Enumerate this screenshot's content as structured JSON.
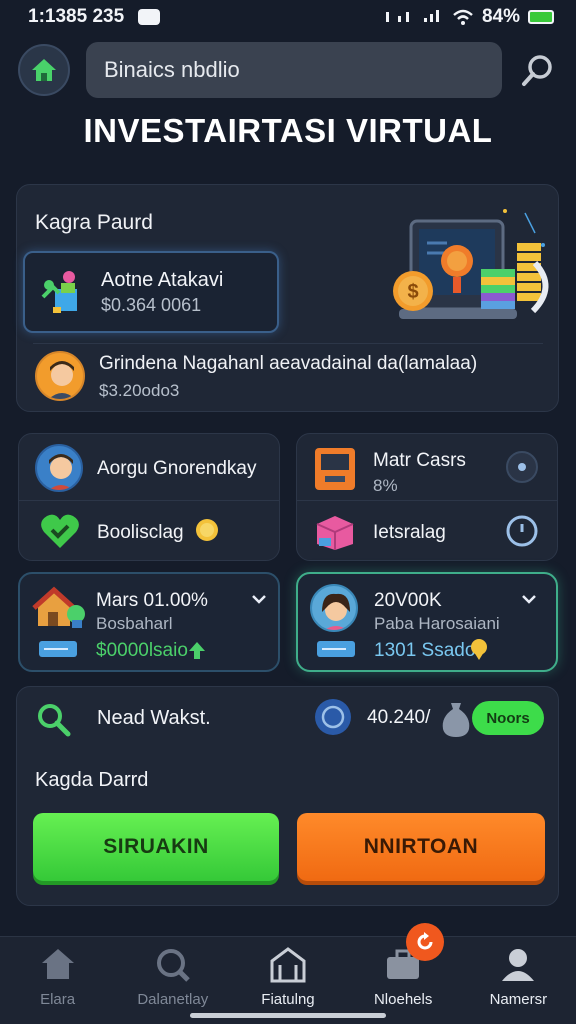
{
  "status": {
    "time": "1:1385 235",
    "battery": "84%"
  },
  "search": {
    "value": "Binaics nbdlio"
  },
  "page": {
    "title": "INVESTAIRTASI VIRTUAL"
  },
  "portfolio": {
    "title": "Kagra Paurd",
    "active_asset": {
      "name": "Aotne Atakavi",
      "value": "$0.364 0061"
    },
    "user": {
      "name": "Grindena Nagahanl aeavadainal da(lamalaa)",
      "value": "$3.20odo3"
    }
  },
  "info_cards": {
    "left_top": {
      "label": "Aorgu Gnorendkay"
    },
    "left_bottom": {
      "label": "Boolisclag"
    },
    "right_top": {
      "label": "Matr Casrs",
      "sub": "8%"
    },
    "right_bottom": {
      "label": "Ietsralag"
    }
  },
  "stat_cards": {
    "left": {
      "title": "Mars 01.00%",
      "sub": "Bosbaharl",
      "value": "$0000lsaio"
    },
    "right": {
      "title": "20V00K",
      "sub": "Paba Harosaiani",
      "value": "1301 Ssado"
    }
  },
  "action": {
    "row_label": "Nead Wakst.",
    "row_value": "40.240/",
    "toggle": "Noors",
    "section_label": "Kagda Darrd",
    "btn_primary": "SIRUAKIN",
    "btn_secondary": "NNIRTOAN"
  },
  "nav": [
    {
      "label": "Elara",
      "active": false
    },
    {
      "label": "Dalanetlay",
      "active": false
    },
    {
      "label": "Fiatulng",
      "active": true
    },
    {
      "label": "Nloehels",
      "active": true
    },
    {
      "label": "Namersr",
      "active": true
    }
  ],
  "colors": {
    "accent_green": "#3ddc4a",
    "accent_orange": "#f06a12",
    "background": "#151c2a"
  }
}
